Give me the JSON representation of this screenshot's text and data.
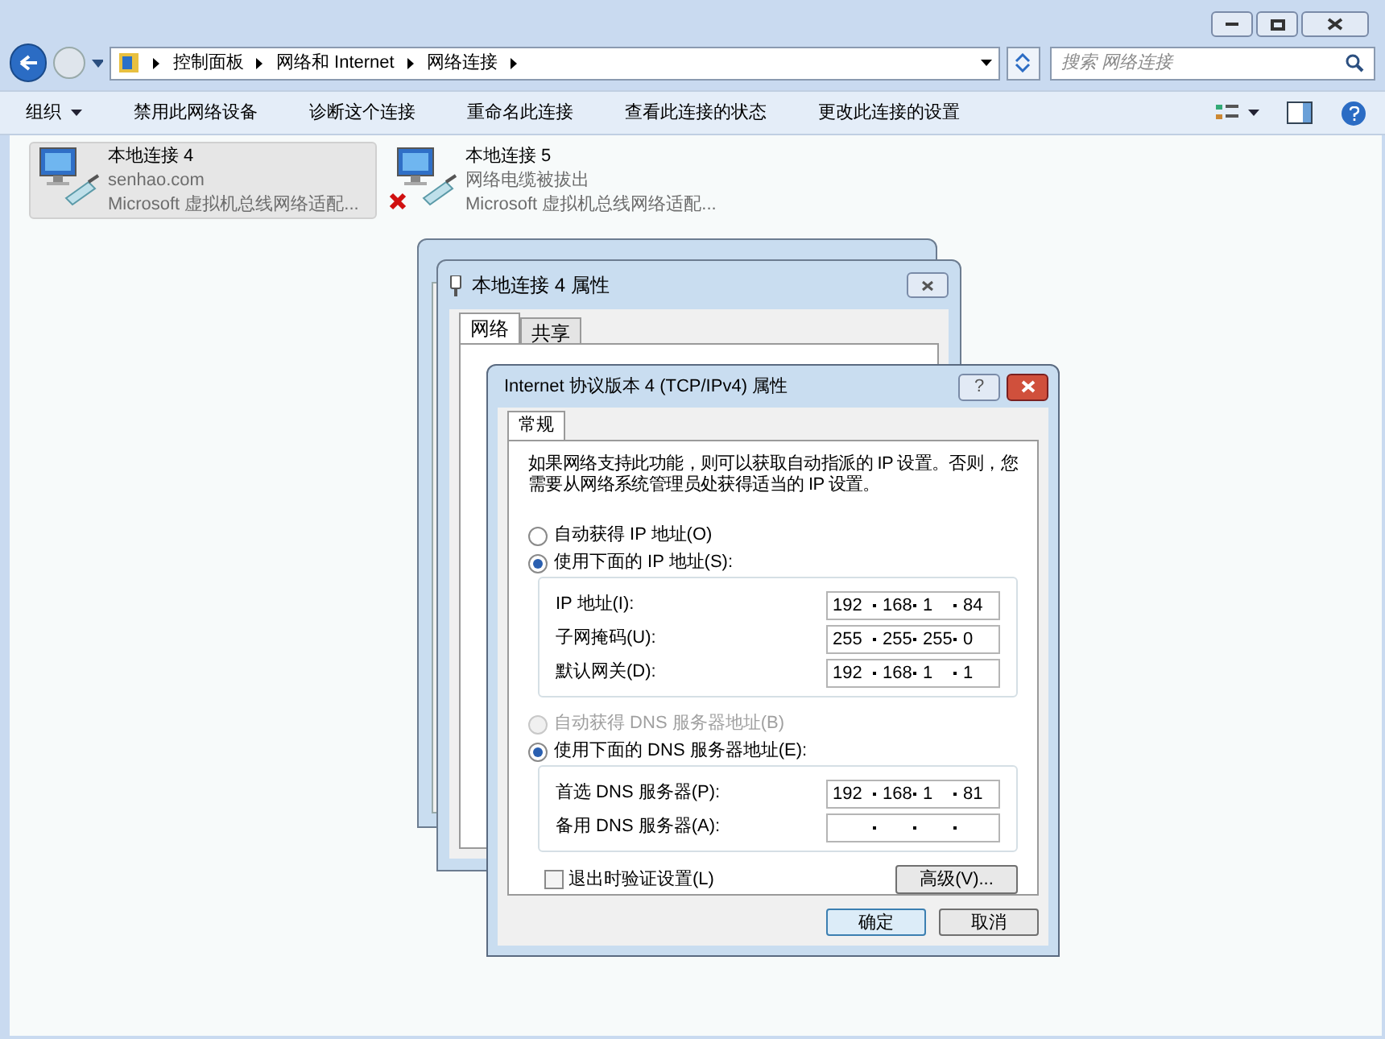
{
  "explorer": {
    "breadcrumb": [
      "控制面板",
      "网络和 Internet",
      "网络连接"
    ],
    "search": {
      "placeholder": "搜索 网络连接"
    },
    "toolbar": [
      {
        "label": "组织",
        "dropdown": true
      },
      {
        "label": "禁用此网络设备",
        "dropdown": false
      },
      {
        "label": "诊断这个连接",
        "dropdown": false
      },
      {
        "label": "重命名此连接",
        "dropdown": false
      },
      {
        "label": "查看此连接的状态",
        "dropdown": false
      },
      {
        "label": "更改此连接的设置",
        "dropdown": false
      }
    ],
    "connections": [
      {
        "name": "本地连接 4",
        "status": "senhao.com",
        "adapter": "Microsoft 虚拟机总线网络适配...",
        "selected": true,
        "disconnected": false
      },
      {
        "name": "本地连接 5",
        "status": "网络电缆被拔出",
        "adapter": "Microsoft 虚拟机总线网络适配...",
        "selected": false,
        "disconnected": true
      }
    ]
  },
  "properties_window": {
    "title": "本地连接 4 属性",
    "tabs": [
      {
        "label": "网络",
        "selected": true
      },
      {
        "label": "共享",
        "selected": false
      }
    ]
  },
  "ipv4_dialog": {
    "title": "Internet 协议版本 4 (TCP/IPv4) 属性",
    "tabs": [
      {
        "label": "常规",
        "selected": true
      }
    ],
    "description": "如果网络支持此功能，则可以获取自动指派的 IP 设置。否则，您需要从网络系统管理员处获得适当的 IP 设置。",
    "ip_mode": [
      {
        "label": "自动获得 IP 地址(O)",
        "selected": false,
        "disabled": false
      },
      {
        "label": "使用下面的 IP 地址(S):",
        "selected": true,
        "disabled": false
      }
    ],
    "ip_fields": [
      {
        "label": "IP 地址(I):",
        "octets": [
          "192",
          "168",
          "1",
          "84"
        ]
      },
      {
        "label": "子网掩码(U):",
        "octets": [
          "255",
          "255",
          "255",
          "0"
        ]
      },
      {
        "label": "默认网关(D):",
        "octets": [
          "192",
          "168",
          "1",
          "1"
        ]
      }
    ],
    "dns_mode": [
      {
        "label": "自动获得 DNS 服务器地址(B)",
        "selected": false,
        "disabled": true
      },
      {
        "label": "使用下面的 DNS 服务器地址(E):",
        "selected": true,
        "disabled": false
      }
    ],
    "dns_fields": [
      {
        "label": "首选 DNS 服务器(P):",
        "octets": [
          "192",
          "168",
          "1",
          "81"
        ]
      },
      {
        "label": "备用 DNS 服务器(A):"
      }
    ],
    "validate": {
      "label": "退出时验证设置(L)",
      "checked": false
    },
    "advanced_button": "高级(V)...",
    "ok_button": "确定",
    "cancel_button": "取消",
    "help_button": "?"
  }
}
